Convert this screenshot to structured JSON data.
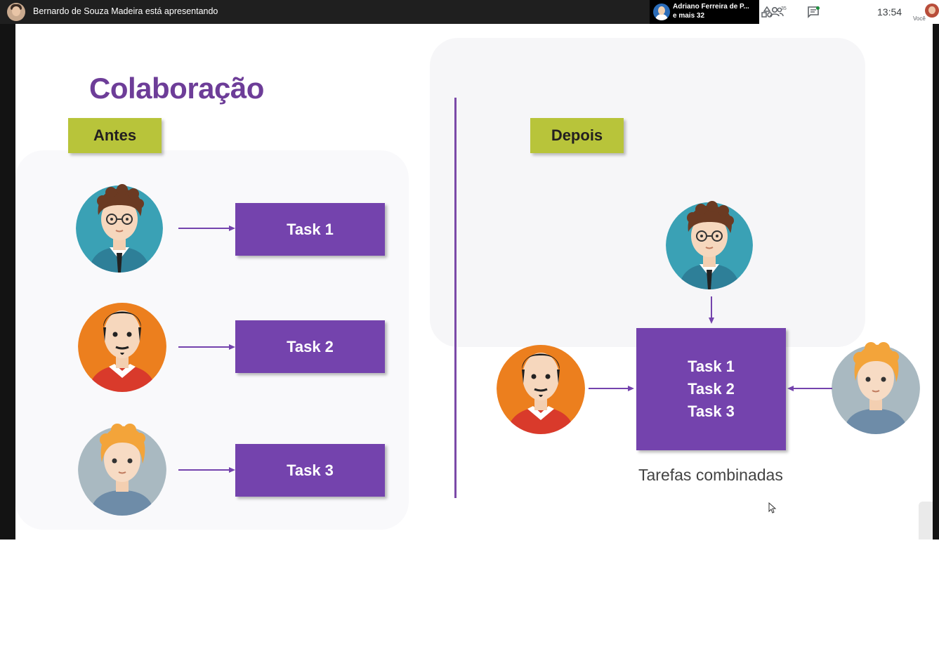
{
  "topbar": {
    "presenter_text": "Bernardo de Souza Madeira está apresentando",
    "participant_chip": {
      "name": "Adriano Ferreira de P...",
      "more": "e mais 32"
    },
    "people_count": "35",
    "clock": "13:54",
    "you_label": "Você",
    "icons": [
      "people-icon",
      "chat-icon",
      "activities-icon"
    ]
  },
  "slide": {
    "title": "Colaboração",
    "before_label": "Antes",
    "after_label": "Depois",
    "before_tasks": [
      "Task 1",
      "Task 2",
      "Task 3"
    ],
    "combined_tasks": [
      "Task 1",
      "Task 2",
      "Task 3"
    ],
    "caption": "Tarefas combinadas",
    "colors": {
      "purple": "#7443ad",
      "title": "#6d3d98",
      "badge": "#b8c43a"
    }
  }
}
